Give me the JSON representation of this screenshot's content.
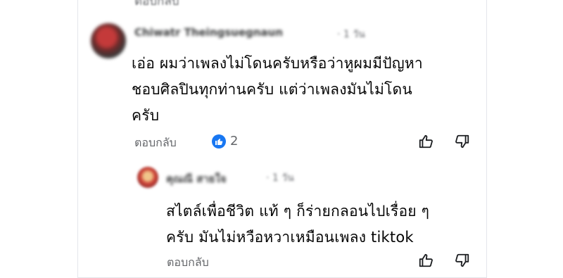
{
  "top": {
    "reply_label": "ตอบกลับ"
  },
  "comments": [
    {
      "author": "Chiwatr Theingsuegnaun",
      "time": "· 1 วัน",
      "text_lines": [
        "เอ่อ ผมว่าเพลงไม่โดนครับหรือว่าหูผมมีปัญหา",
        "ชอบศิลปินทุกท่านครับ แต่ว่าเพลงมันไม่โดน",
        "ครับ"
      ],
      "reply_label": "ตอบกลับ",
      "reaction": {
        "icon": "like-icon",
        "count": "2"
      },
      "colors": {
        "like": "#1877f2"
      }
    },
    {
      "author": "คุณณี สายใจ",
      "time": "· 1 วัน",
      "text_lines": [
        "สไตล์เพื่อชีวิต แท้ ๆ  ก็ร่ายกลอนไปเรื่อย ๆ",
        "ครับ มันไม่หวือหวาเหมือนเพลง tiktok"
      ],
      "reply_label": "ตอบกลับ"
    }
  ]
}
